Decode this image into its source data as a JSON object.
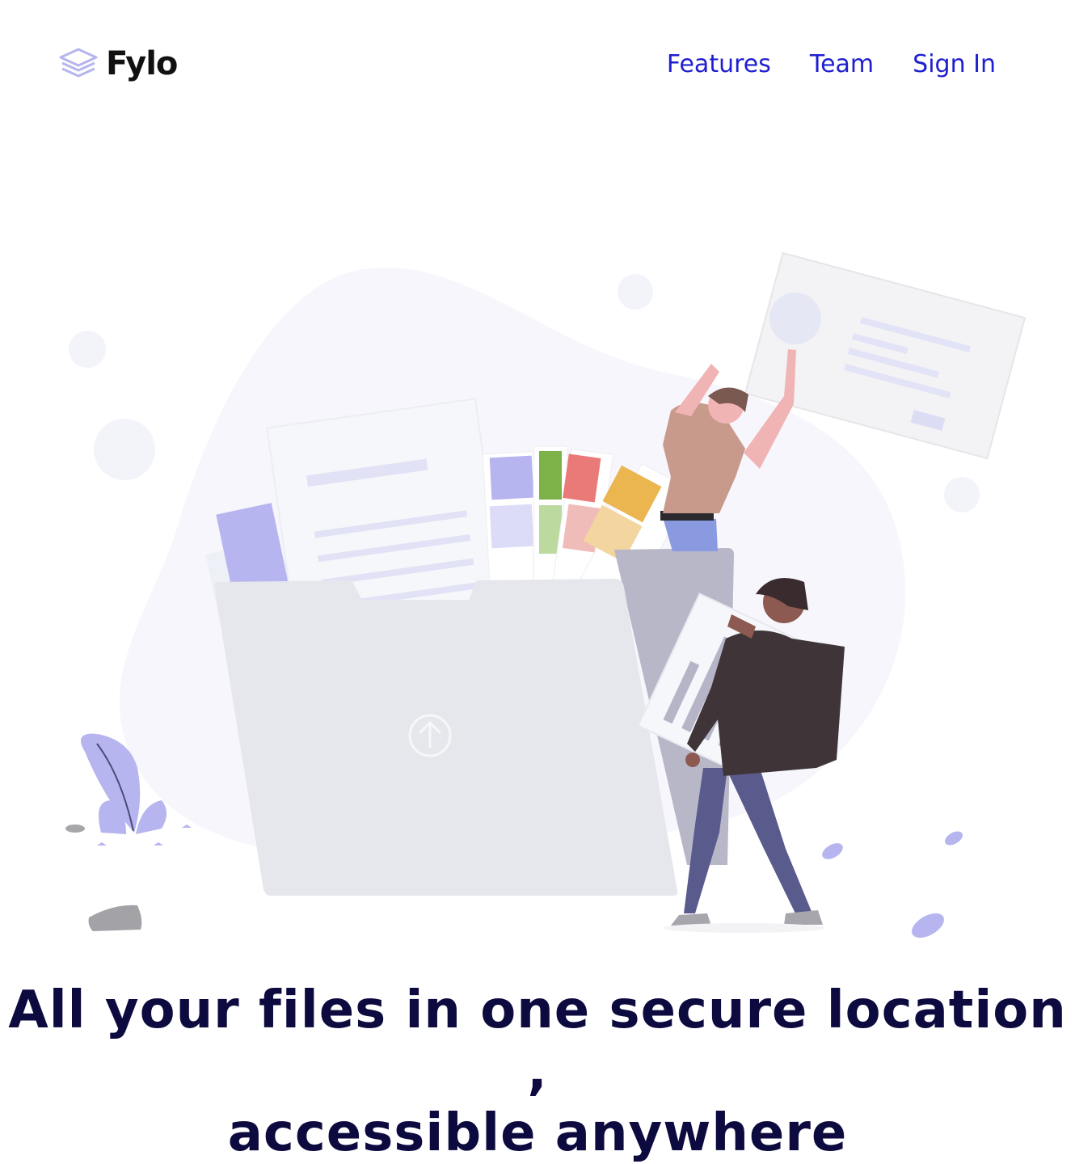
{
  "brand": {
    "name": "Fylo",
    "icon": "layers-icon"
  },
  "nav": {
    "items": [
      {
        "label": "Features"
      },
      {
        "label": "Team"
      },
      {
        "label": "Sign In"
      }
    ]
  },
  "hero": {
    "illustration_icons": [
      "folder-icon",
      "upload-arrow-icon",
      "document-icon",
      "color-swatch-icon",
      "person-icon",
      "plant-icon",
      "leaf-icon"
    ],
    "title_line1": "All your files in one secure location ,",
    "title_line2": "accessible anywhere"
  },
  "colors": {
    "nav_link": "#1f1fd0",
    "title": "#0c0a3e",
    "accent": "#b6b5ef"
  }
}
